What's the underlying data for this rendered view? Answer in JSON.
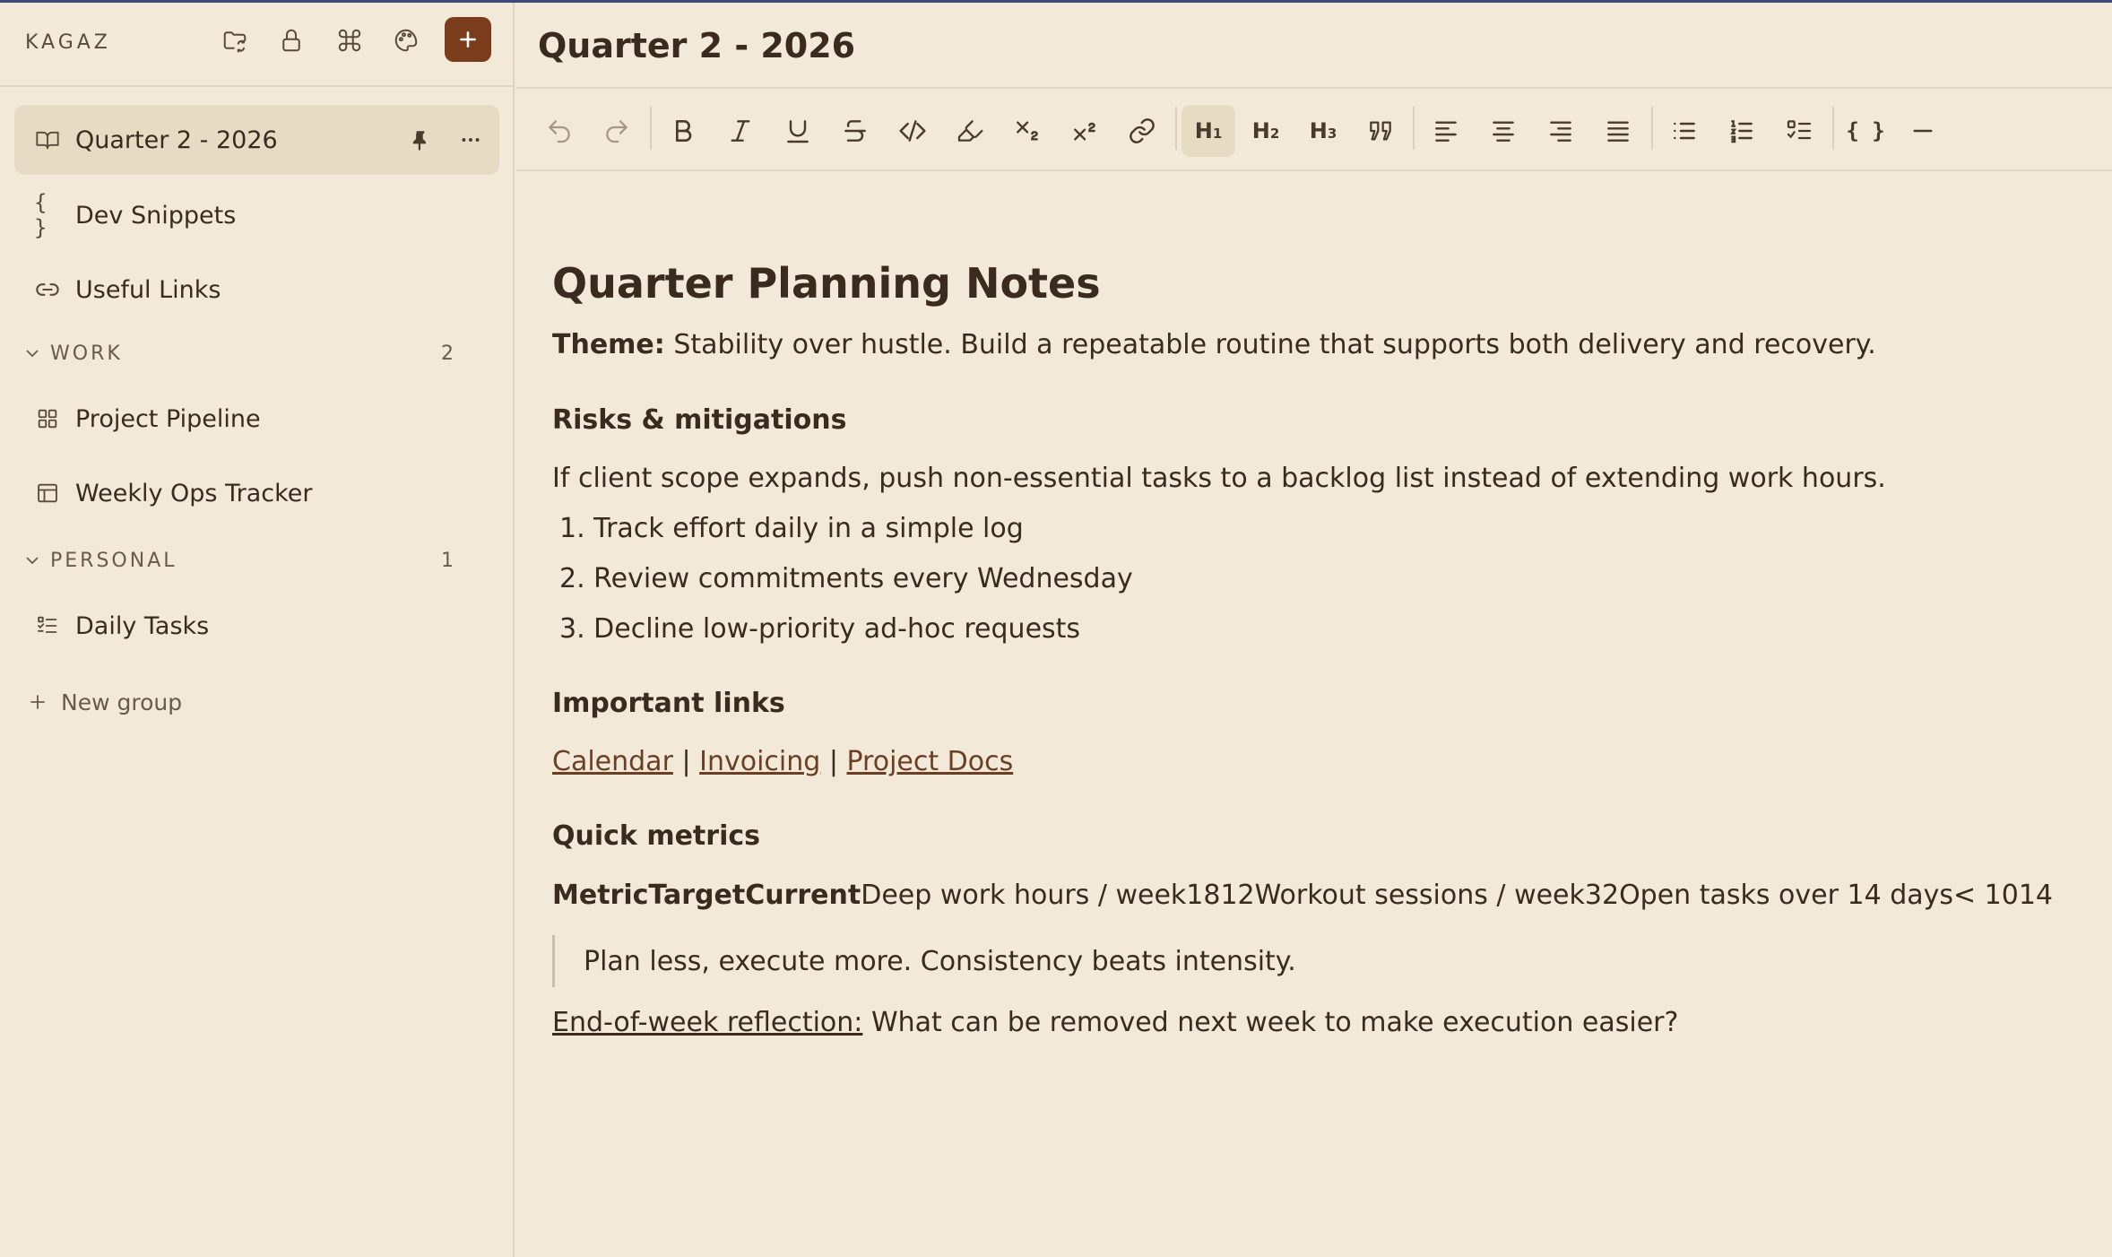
{
  "sidebar": {
    "brand": "KAGAZ",
    "pinned_items": [
      {
        "label": "Quarter 2 - 2026",
        "icon": "book-icon",
        "active": true
      },
      {
        "label": "Dev Snippets",
        "icon": "braces-icon"
      },
      {
        "label": "Useful Links",
        "icon": "link-icon"
      }
    ],
    "groups": [
      {
        "label": "WORK",
        "count": "2",
        "items": [
          {
            "label": "Project Pipeline",
            "icon": "grid-icon"
          },
          {
            "label": "Weekly Ops Tracker",
            "icon": "table-icon"
          }
        ]
      },
      {
        "label": "PERSONAL",
        "count": "1",
        "items": [
          {
            "label": "Daily Tasks",
            "icon": "checklist-icon"
          }
        ]
      }
    ],
    "new_group": "New group"
  },
  "header": {
    "title": "Quarter 2 - 2026"
  },
  "toolbar": {
    "h1": "H",
    "h1_sub": "1",
    "h2": "H",
    "h2_sub": "2",
    "h3": "H",
    "h3_sub": "3",
    "code_block": "{ }"
  },
  "doc": {
    "title": "Quarter Planning Notes",
    "theme_label": "Theme:",
    "theme_text": " Stability over hustle. Build a repeatable routine that supports both delivery and recovery.",
    "risks_heading": "Risks & mitigations",
    "risks_text": "If client scope expands, push non-essential tasks to a backlog list instead of extending work hours.",
    "list": [
      "1. Track effort daily in a simple log",
      "2. Review commitments every Wednesday",
      "3. Decline low-priority ad-hoc requests"
    ],
    "links_heading": "Important links",
    "links": [
      "Calendar",
      "Invoicing",
      "Project Docs"
    ],
    "link_sep": " | ",
    "metrics_heading": "Quick metrics",
    "metrics_header": "MetricTargetCurrent",
    "metrics_rows": "Deep work hours / week1812Workout sessions / week32Open tasks over 14 days< 1014",
    "quote": "Plan less, execute more. Consistency beats intensity.",
    "reflection_label": "End-of-week reflection:",
    "reflection_text": " What can be removed next week to make execution easier?"
  },
  "colors": {
    "accent": "#7a3c1a",
    "background": "#f2e9d8",
    "active_bg": "#e8dbc4"
  }
}
